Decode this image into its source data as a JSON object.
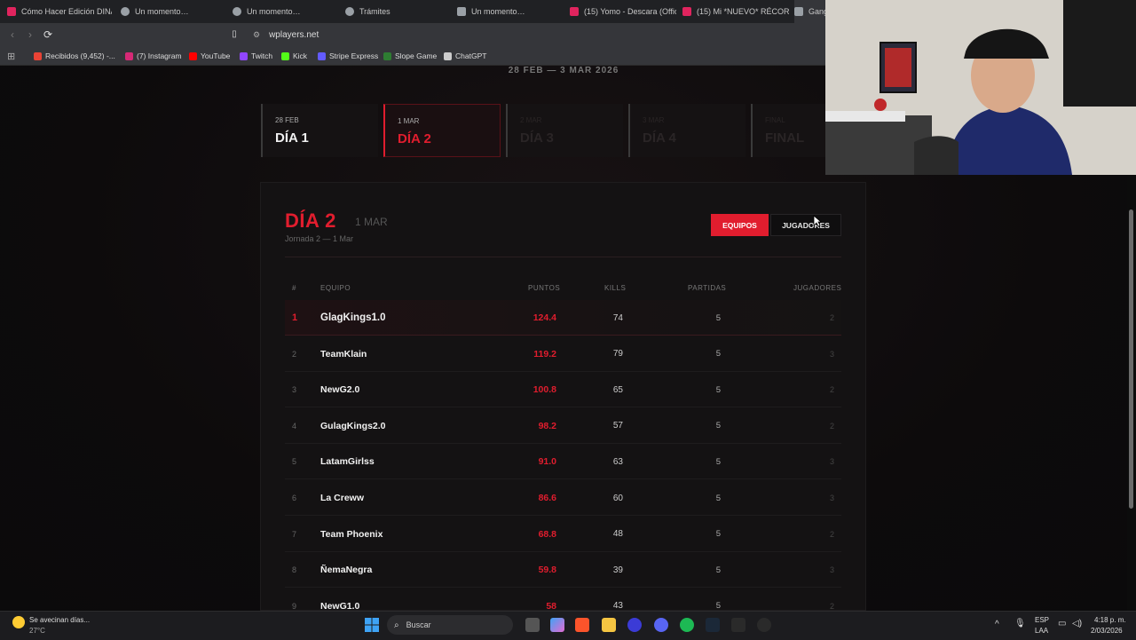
{
  "browser": {
    "tabs": [
      {
        "title": "Cómo Hacer Edición DINÁ",
        "icon": "youtube-icon",
        "color": "#e0245e"
      },
      {
        "title": "Un momento…",
        "icon": "globe-icon",
        "color": "#9aa0a6"
      },
      {
        "title": "Un momento…",
        "icon": "globe-icon",
        "color": "#9aa0a6"
      },
      {
        "title": "Trámites",
        "icon": "globe-icon",
        "color": "#9aa0a6"
      },
      {
        "title": "Un momento…",
        "icon": "page-icon",
        "color": "#9aa0a6"
      },
      {
        "title": "(15) Yomo - Descara (Offic",
        "icon": "youtube-icon",
        "color": "#e0245e"
      },
      {
        "title": "(15) Mi *NUEVO* RÉCORD",
        "icon": "youtube-icon",
        "color": "#e0245e"
      },
      {
        "title": "Gang",
        "icon": "site-icon",
        "color": "#9aa0a6"
      }
    ],
    "url": "wplayers.net",
    "bookmarks": [
      {
        "label": "Recibidos (9,452) -...",
        "icon": "gmail-icon",
        "color": "#ea4335"
      },
      {
        "label": "(7) Instagram",
        "icon": "instagram-icon",
        "color": "#d62976"
      },
      {
        "label": "YouTube",
        "icon": "youtube-icon",
        "color": "#ff0000"
      },
      {
        "label": "Twitch",
        "icon": "twitch-icon",
        "color": "#9146ff"
      },
      {
        "label": "Kick",
        "icon": "kick-icon",
        "color": "#53fc18"
      },
      {
        "label": "Stripe Express",
        "icon": "stripe-icon",
        "color": "#635bff"
      },
      {
        "label": "Slope Game",
        "icon": "game-icon",
        "color": "#2e7d32"
      },
      {
        "label": "ChatGPT",
        "icon": "chatgpt-icon",
        "color": "#cccccc"
      }
    ]
  },
  "page": {
    "date_range": "28 FEB — 3 MAR 2026",
    "days": [
      {
        "date": "28 FEB",
        "name": "DÍA 1",
        "state": "normal"
      },
      {
        "date": "1 MAR",
        "name": "DÍA 2",
        "state": "active"
      },
      {
        "date": "2 MAR",
        "name": "DÍA 3",
        "state": "dim"
      },
      {
        "date": "3 MAR",
        "name": "DÍA 4",
        "state": "dim"
      },
      {
        "date": "FINAL",
        "name": "FINAL",
        "state": "dim"
      }
    ],
    "panel": {
      "title": "DÍA 2",
      "date": "1 MAR",
      "subtitle": "Jornada 2 — 1 Mar",
      "btn_teams": "EQUIPOS",
      "btn_players": "JUGADORES"
    },
    "table": {
      "headers": {
        "rank": "#",
        "team": "EQUIPO",
        "points": "PUNTOS",
        "kills": "KILLS",
        "matches": "PARTIDAS",
        "players": "JUGADORES"
      },
      "rows": [
        {
          "rank": "1",
          "team": "GlagKings1.0",
          "points": "124.4",
          "kills": "74",
          "matches": "5",
          "players": "2"
        },
        {
          "rank": "2",
          "team": "TeamKlain",
          "points": "119.2",
          "kills": "79",
          "matches": "5",
          "players": "3"
        },
        {
          "rank": "3",
          "team": "NewG2.0",
          "points": "100.8",
          "kills": "65",
          "matches": "5",
          "players": "2"
        },
        {
          "rank": "4",
          "team": "GulagKings2.0",
          "points": "98.2",
          "kills": "57",
          "matches": "5",
          "players": "2"
        },
        {
          "rank": "5",
          "team": "LatamGirlss",
          "points": "91.0",
          "kills": "63",
          "matches": "5",
          "players": "3"
        },
        {
          "rank": "6",
          "team": "La Creww",
          "points": "86.6",
          "kills": "60",
          "matches": "5",
          "players": "3"
        },
        {
          "rank": "7",
          "team": "Team Phoenix",
          "points": "68.8",
          "kills": "48",
          "matches": "5",
          "players": "2"
        },
        {
          "rank": "8",
          "team": "ÑemaNegra",
          "points": "59.8",
          "kills": "39",
          "matches": "5",
          "players": "3"
        },
        {
          "rank": "9",
          "team": "NewG1.0",
          "points": "58",
          "kills": "43",
          "matches": "5",
          "players": "2"
        }
      ]
    }
  },
  "taskbar": {
    "weather_text": "Se avecinan días...",
    "temperature": "27°C",
    "search_placeholder": "Buscar",
    "lang_line1": "ESP",
    "lang_line2": "LAA",
    "time": "4:18 p. m.",
    "date": "2/03/2026"
  },
  "colors": {
    "accent": "#e11d2e"
  }
}
